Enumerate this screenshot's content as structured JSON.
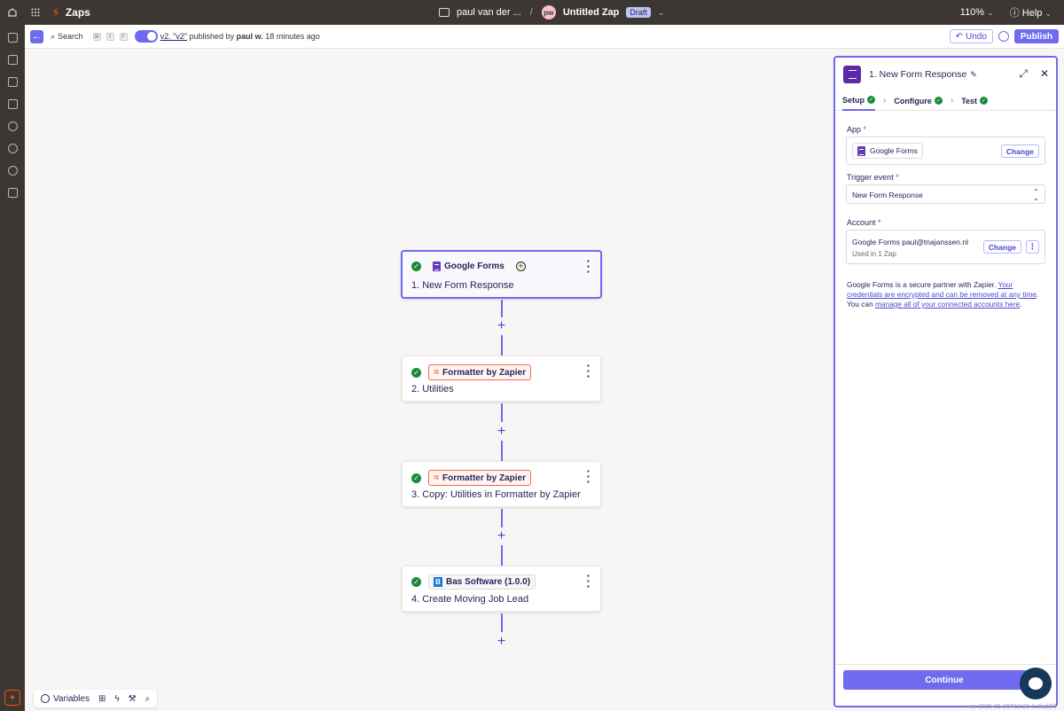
{
  "topbar": {
    "app_name": "Zaps",
    "folder": "paul van der ...",
    "separator": "/",
    "avatar_initials": "pw",
    "zap_title": "Untitled Zap",
    "draft_badge": "Draft",
    "zoom": "110%",
    "help": "Help"
  },
  "subbar": {
    "search_label": "Search",
    "shortcut_keys": [
      "⌘",
      "⇧",
      "F"
    ],
    "version_link": "v2. \"v2\"",
    "published_by": " published by ",
    "author": "paul w.",
    "time_ago": " 18 minutes ago",
    "undo": "Undo",
    "publish": "Publish"
  },
  "steps": [
    {
      "app": "Google Forms",
      "title": "1. New Form Response"
    },
    {
      "app": "Formatter by Zapier",
      "title": "2. Utilities"
    },
    {
      "app": "Formatter by Zapier",
      "title": "3. Copy: Utilities in Formatter by Zapier"
    },
    {
      "app": "Bas Software (1.0.0)",
      "title": "4. Create Moving Job Lead"
    }
  ],
  "bottom_toolbar": {
    "variables": "Variables"
  },
  "panel": {
    "title": "1. New Form Response",
    "tabs": [
      "Setup",
      "Configure",
      "Test"
    ],
    "app_label": "App",
    "app_value": "Google Forms",
    "change": "Change",
    "trigger_label": "Trigger event",
    "trigger_value": "New Form Response",
    "account_label": "Account",
    "account_value": "Google Forms paul@tnajanssen.nl",
    "account_sub": "Used in 1 Zap",
    "required_mark": "*",
    "notice_pre": "Google Forms is a secure partner with Zapier. ",
    "notice_link1": "Your credentials are encrypted and can be removed at any time",
    "notice_mid": ". You can ",
    "notice_link2": "manage all of your connected accounts here",
    "notice_post": ".",
    "continue": "Continue"
  },
  "version_footer": "ver. 2025-05-06T13:30-1c0ad3f1",
  "colors": {
    "accent": "#6e6bf0",
    "brand": "#ff4f00",
    "topbar": "#3d3733",
    "success": "#1a8a3a"
  }
}
